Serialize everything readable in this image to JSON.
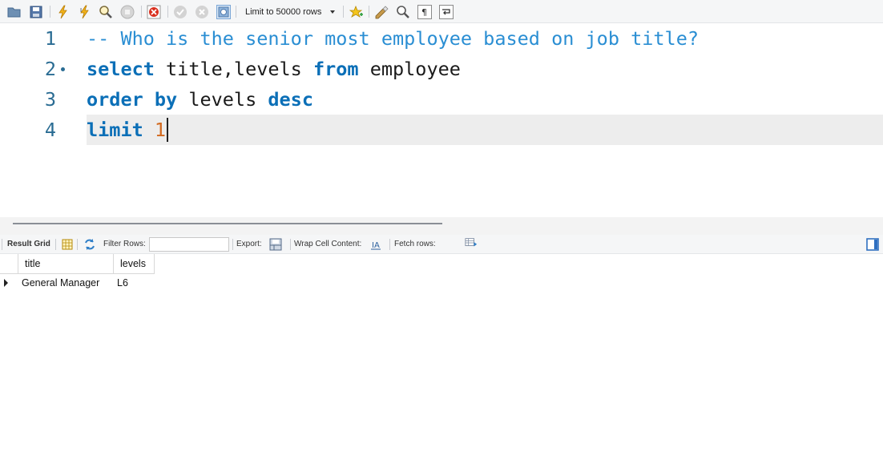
{
  "toolbar": {
    "limit_label": "Limit to 50000 rows",
    "icons": [
      "open-folder-icon",
      "save-icon",
      "execute-icon",
      "execute-current-icon",
      "explain-icon",
      "stop-icon",
      "toggle-error-icon",
      "commit-icon",
      "rollback-icon",
      "autocommit-icon",
      "bookmark-icon",
      "beautify-icon",
      "find-icon",
      "invisible-chars-icon",
      "wrap-lines-icon"
    ]
  },
  "editor": {
    "lines": [
      {
        "number": "1",
        "text": "-- Who is the senior most employee based on job title?"
      },
      {
        "number": "2",
        "kw1": "select",
        "mid": " title,levels ",
        "kw2": "from",
        "tail": " employee"
      },
      {
        "number": "3",
        "kw1": "order by",
        "mid": " levels ",
        "kw2": "desc"
      },
      {
        "number": "4",
        "kw1": "limit",
        "num": "1"
      }
    ]
  },
  "result_toolbar": {
    "result_grid_label": "Result Grid",
    "filter_label": "Filter Rows:",
    "filter_value": "",
    "export_label": "Export:",
    "wrap_label": "Wrap Cell Content:",
    "fetch_label": "Fetch rows:"
  },
  "grid": {
    "columns": [
      "title",
      "levels"
    ],
    "rows": [
      [
        "General Manager",
        "L6"
      ]
    ]
  },
  "colors": {
    "keyword": "#0b6fb7",
    "comment": "#2a8ed3",
    "number": "#d2691e",
    "line_number": "#2a6c93",
    "active_line_bg": "#ededed"
  }
}
